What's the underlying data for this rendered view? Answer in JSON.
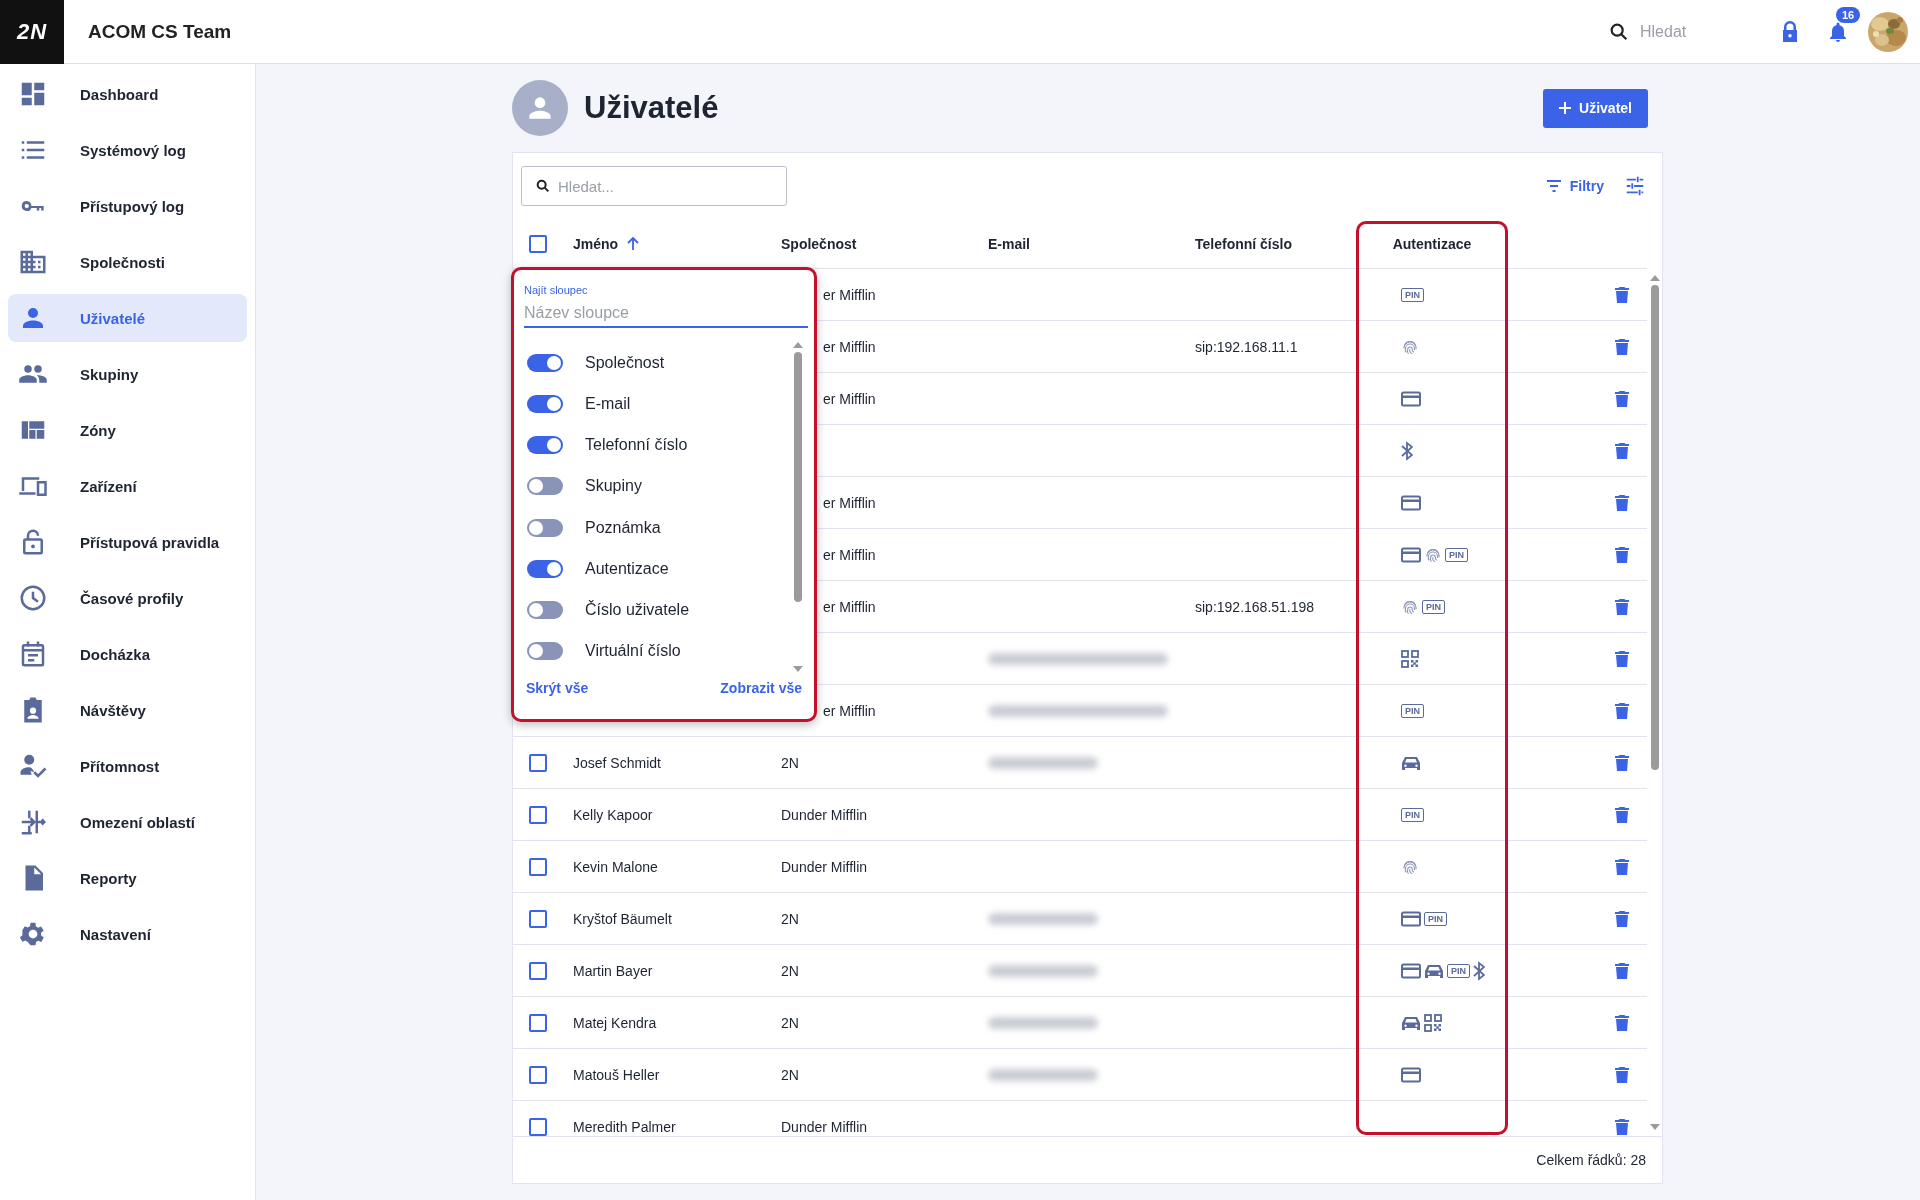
{
  "app_bar": {
    "logo": "2N",
    "title": "ACOM CS Team",
    "search": {
      "placeholder": "Hledat"
    },
    "notifications": {
      "count": "16"
    }
  },
  "sidebar": {
    "items": [
      {
        "label": "Dashboard",
        "selected": false
      },
      {
        "label": "Systémový log",
        "selected": false
      },
      {
        "label": "Přístupový log",
        "selected": false
      },
      {
        "label": "Společnosti",
        "selected": false
      },
      {
        "label": "Uživatelé",
        "selected": true
      },
      {
        "label": "Skupiny",
        "selected": false
      },
      {
        "label": "Zóny",
        "selected": false
      },
      {
        "label": "Zařízení",
        "selected": false
      },
      {
        "label": "Přístupová pravidla",
        "selected": false
      },
      {
        "label": "Časové profily",
        "selected": false
      },
      {
        "label": "Docházka",
        "selected": false
      },
      {
        "label": "Návštěvy",
        "selected": false
      },
      {
        "label": "Přítomnost",
        "selected": false
      },
      {
        "label": "Omezení oblastí",
        "selected": false
      },
      {
        "label": "Reporty",
        "selected": false
      },
      {
        "label": "Nastavení",
        "selected": false
      }
    ]
  },
  "page": {
    "title": "Uživatelé",
    "add_button": "Uživatel"
  },
  "toolbar": {
    "search": {
      "placeholder": "Hledat..."
    },
    "filters_button": "Filtry"
  },
  "table": {
    "select_all_checked": false,
    "columns": [
      {
        "label": "Jméno",
        "sorted": true,
        "highlighted": false
      },
      {
        "label": "Společnost",
        "sorted": false,
        "highlighted": false
      },
      {
        "label": "E-mail",
        "sorted": false,
        "highlighted": false
      },
      {
        "label": "Telefonní číslo",
        "sorted": false,
        "highlighted": false
      },
      {
        "label": "Autentizace",
        "sorted": false,
        "highlighted": true
      }
    ],
    "rows": [
      {
        "company": "er Mifflin",
        "auth": [
          {
            "kind": "pin",
            "text": "PIN"
          }
        ]
      },
      {
        "company": "er Mifflin",
        "phone": "sip:192.168.11.1",
        "auth": [
          {
            "kind": "fingerprint"
          }
        ]
      },
      {
        "company": "er Mifflin",
        "auth": [
          {
            "kind": "card"
          }
        ]
      },
      {
        "auth": [
          {
            "kind": "bluetooth"
          }
        ]
      },
      {
        "company": "er Mifflin",
        "auth": [
          {
            "kind": "card"
          }
        ]
      },
      {
        "company": "er Mifflin",
        "auth": [
          {
            "kind": "card"
          },
          {
            "kind": "fingerprint"
          },
          {
            "kind": "pin",
            "text": "PIN"
          }
        ]
      },
      {
        "company": "er Mifflin",
        "phone": "sip:192.168.51.198",
        "auth": [
          {
            "kind": "fingerprint"
          },
          {
            "kind": "pin",
            "text": "PIN"
          }
        ]
      },
      {
        "email_blurred": true,
        "auth": [
          {
            "kind": "qr"
          }
        ]
      },
      {
        "company": "er Mifflin",
        "email_blurred": true,
        "auth": [
          {
            "kind": "pin",
            "text": "PIN"
          }
        ]
      },
      {
        "checked": false,
        "name": "Josef Schmidt",
        "company": "2N",
        "email_blurred": true,
        "auth": [
          {
            "kind": "car"
          }
        ]
      },
      {
        "checked": false,
        "name": "Kelly Kapoor",
        "company": "Dunder Mifflin",
        "auth": [
          {
            "kind": "pin",
            "text": "PIN"
          }
        ]
      },
      {
        "checked": false,
        "name": "Kevin Malone",
        "company": "Dunder Mifflin",
        "auth": [
          {
            "kind": "fingerprint"
          }
        ]
      },
      {
        "checked": false,
        "name": "Kryštof Bäumelt",
        "company": "2N",
        "email_blurred": true,
        "auth": [
          {
            "kind": "card"
          },
          {
            "kind": "pin",
            "text": "PIN"
          }
        ]
      },
      {
        "checked": false,
        "name": "Martin Bayer",
        "company": "2N",
        "email_blurred": true,
        "auth": [
          {
            "kind": "card"
          },
          {
            "kind": "car"
          },
          {
            "kind": "pin",
            "text": "PIN"
          },
          {
            "kind": "bluetooth"
          }
        ]
      },
      {
        "checked": false,
        "name": "Matej Kendra",
        "company": "2N",
        "email_blurred": true,
        "auth": [
          {
            "kind": "car"
          },
          {
            "kind": "qr"
          }
        ]
      },
      {
        "checked": false,
        "name": "Matouš Heller",
        "company": "2N",
        "email_blurred": true,
        "auth": [
          {
            "kind": "card"
          }
        ]
      },
      {
        "checked": false,
        "name": "Meredith Palmer",
        "company": "Dunder Mifflin",
        "auth": []
      }
    ],
    "total": "Celkem řádků: 28"
  },
  "column_popup": {
    "highlighted": true,
    "label": "Najít sloupec",
    "placeholder": "Název sloupce",
    "columns": [
      {
        "label": "Společnost",
        "on": true
      },
      {
        "label": "E-mail",
        "on": true
      },
      {
        "label": "Telefonní číslo",
        "on": true
      },
      {
        "label": "Skupiny",
        "on": false
      },
      {
        "label": "Poznámka",
        "on": false
      },
      {
        "label": "Autentizace",
        "on": true
      },
      {
        "label": "Číslo uživatele",
        "on": false
      },
      {
        "label": "Virtuální číslo",
        "on": false
      }
    ],
    "hide_all": "Skrýt vše",
    "show_all": "Zobrazit vše"
  }
}
